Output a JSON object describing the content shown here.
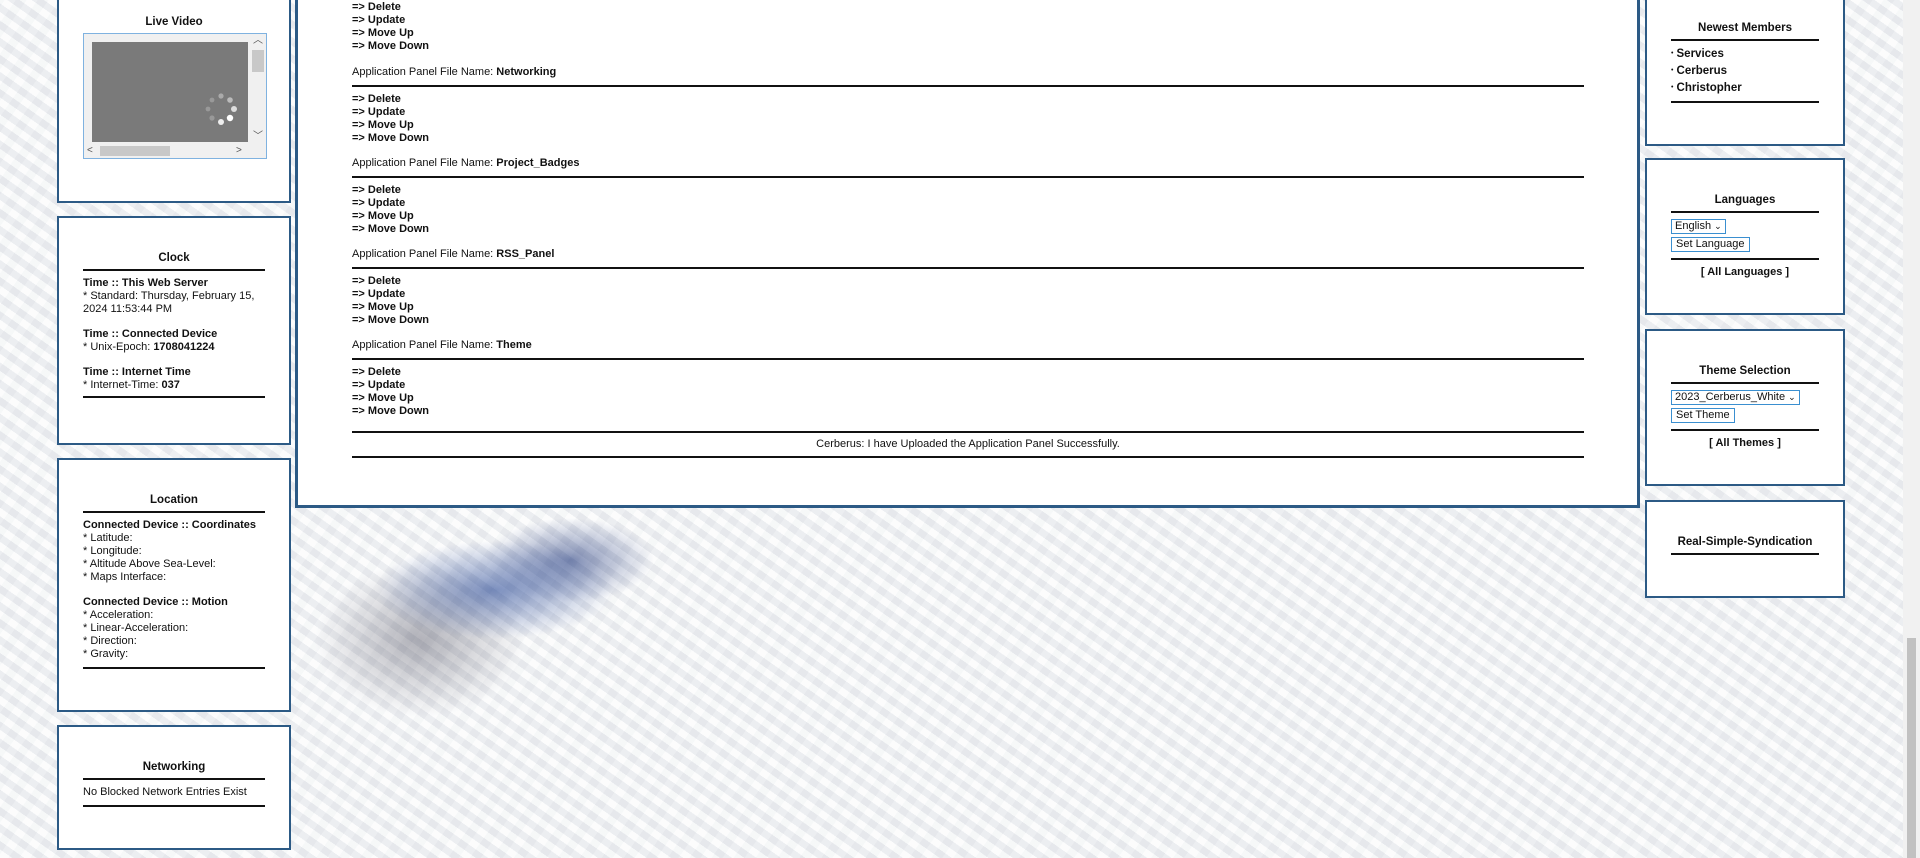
{
  "live_video": {
    "title": "Live Video"
  },
  "clock": {
    "title": "Clock",
    "server_heading": "Time :: This Web Server",
    "server_line1": "* Standard: Thursday, February 15,",
    "server_line2": "2024 11:53:44 PM",
    "device_heading": "Time :: Connected Device",
    "device_prefix": "* Unix-Epoch: ",
    "device_value": "1708041224",
    "internet_heading": "Time :: Internet Time",
    "internet_prefix": "* Internet-Time: ",
    "internet_value": "037"
  },
  "location": {
    "title": "Location",
    "coords_heading": "Connected Device :: Coordinates",
    "coords": [
      "* Latitude:",
      "* Longitude:",
      "* Altitude Above Sea-Level:",
      "* Maps Interface:"
    ],
    "motion_heading": "Connected Device :: Motion",
    "motion": [
      "* Acceleration:",
      "* Linear-Acceleration:",
      "* Direction:",
      "* Gravity:"
    ]
  },
  "networking": {
    "title": "Networking",
    "text": "No Blocked Network Entries Exist"
  },
  "center": {
    "top_actions": [
      "=> Delete",
      "=> Update",
      "=> Move Up",
      "=> Move Down"
    ],
    "label": "Application Panel File Name: ",
    "panels": [
      {
        "name": "Networking",
        "actions": [
          "=> Delete",
          "=> Update",
          "=> Move Up",
          "=> Move Down"
        ]
      },
      {
        "name": "Project_Badges",
        "actions": [
          "=> Delete",
          "=> Update",
          "=> Move Up",
          "=> Move Down"
        ]
      },
      {
        "name": "RSS_Panel",
        "actions": [
          "=> Delete",
          "=> Update",
          "=> Move Up",
          "=> Move Down"
        ]
      },
      {
        "name": "Theme",
        "actions": [
          "=> Delete",
          "=> Update",
          "=> Move Up",
          "=> Move Down"
        ]
      }
    ],
    "status": "Cerberus: I have Uploaded the Application Panel Successfully."
  },
  "newest_members": {
    "title": "Newest Members",
    "members": [
      "Services",
      "Cerberus",
      "Christopher"
    ]
  },
  "languages": {
    "title": "Languages",
    "selected": "English",
    "button": "Set Language",
    "all_link": "[ All Languages ]"
  },
  "theme": {
    "title": "Theme Selection",
    "selected": "2023_Cerberus_White",
    "button": "Set Theme",
    "all_link": "[ All Themes ]"
  },
  "rss": {
    "title": "Real-Simple-Syndication"
  }
}
